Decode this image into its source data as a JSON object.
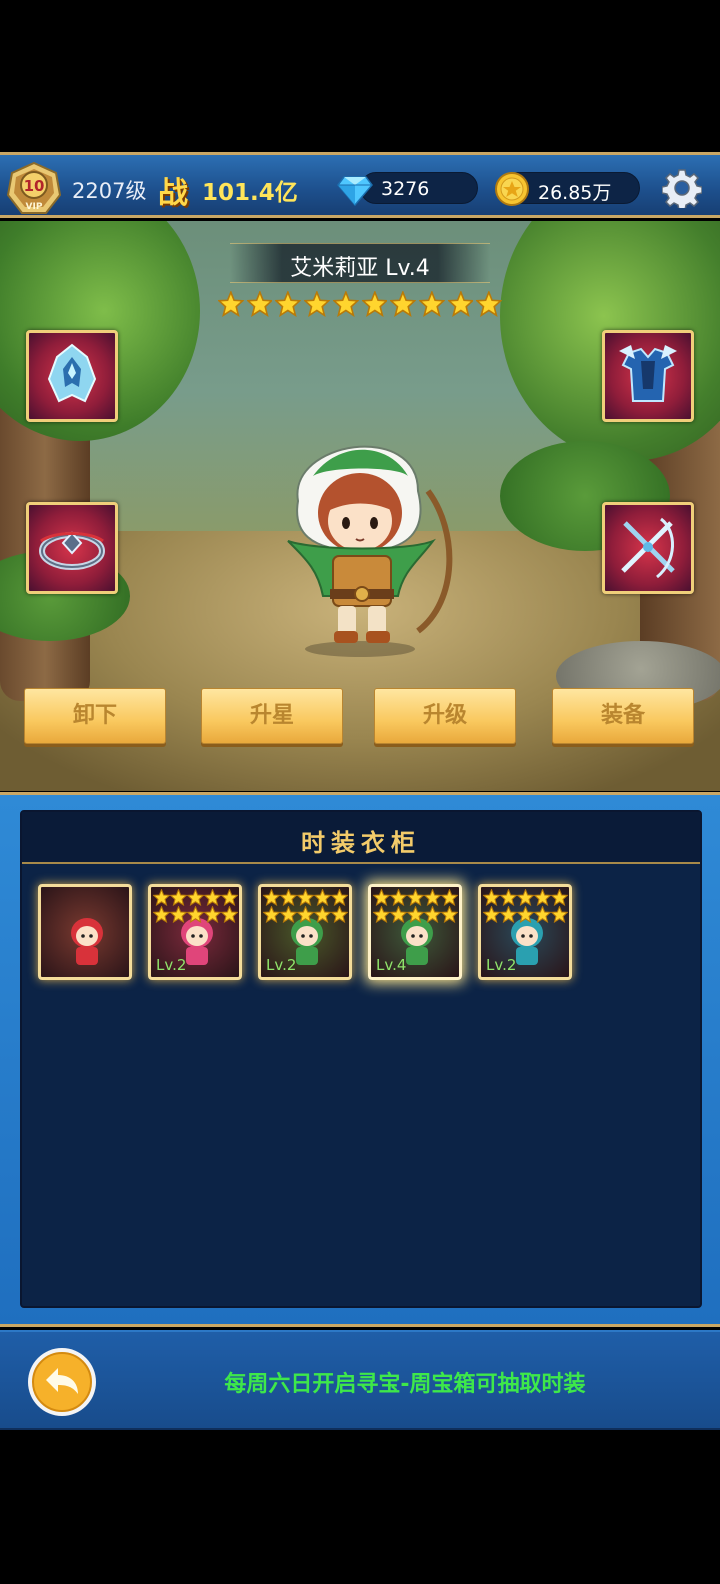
{
  "topbar": {
    "vip_level": "10",
    "player_level": "2207级",
    "power_label": "战",
    "power_value": "101.4亿",
    "gems": "3276",
    "coins": "26.85万",
    "icons": [
      "vip-badge-icon",
      "diamond-icon",
      "gold-coin-icon",
      "gear-icon"
    ]
  },
  "hero": {
    "name": "艾米莉亚 Lv.4",
    "stars": 10
  },
  "equipment_slots": [
    "helmet-icon",
    "armor-icon",
    "ring-icon",
    "weapon-icon"
  ],
  "actions": {
    "unequip": "卸下",
    "star_up": "升星",
    "level_up": "升级",
    "equip": "装备"
  },
  "wardrobe": {
    "title": "时装衣柜",
    "items": [
      {
        "level": "",
        "stars": 0,
        "selected": false
      },
      {
        "level": "Lv.2",
        "stars": 10,
        "selected": false
      },
      {
        "level": "Lv.2",
        "stars": 10,
        "selected": false
      },
      {
        "level": "Lv.4",
        "stars": 10,
        "selected": true
      },
      {
        "level": "Lv.2",
        "stars": 10,
        "selected": false
      }
    ]
  },
  "footer": {
    "tip": "每周六日开启寻宝-周宝箱可抽取时装"
  },
  "colors": {
    "accent_gold": "#f3cb6a",
    "tip_green": "#3ee84a",
    "panel_blue": "#0c2346"
  }
}
